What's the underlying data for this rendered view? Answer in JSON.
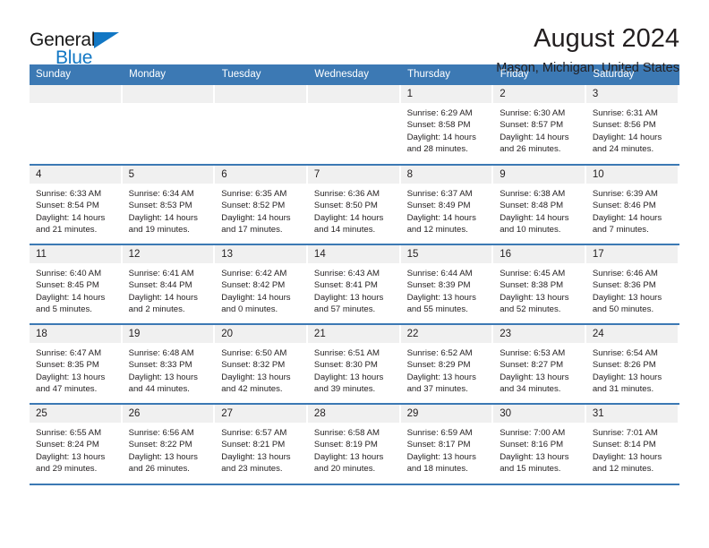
{
  "brand": {
    "name_top": "General",
    "name_bottom": "Blue",
    "accent_color": "#1277c4"
  },
  "header": {
    "title": "August 2024",
    "subtitle": "Mason, Michigan, United States"
  },
  "theme": {
    "header_blue": "#3c79b4",
    "daynum_background": "#f0f0f0",
    "text_color": "#231f20"
  },
  "calendar": {
    "weekday_headers": [
      "Sunday",
      "Monday",
      "Tuesday",
      "Wednesday",
      "Thursday",
      "Friday",
      "Saturday"
    ],
    "weeks": [
      [
        {
          "day": "",
          "lines": []
        },
        {
          "day": "",
          "lines": []
        },
        {
          "day": "",
          "lines": []
        },
        {
          "day": "",
          "lines": []
        },
        {
          "day": "1",
          "lines": [
            "Sunrise: 6:29 AM",
            "Sunset: 8:58 PM",
            "Daylight: 14 hours and 28 minutes."
          ]
        },
        {
          "day": "2",
          "lines": [
            "Sunrise: 6:30 AM",
            "Sunset: 8:57 PM",
            "Daylight: 14 hours and 26 minutes."
          ]
        },
        {
          "day": "3",
          "lines": [
            "Sunrise: 6:31 AM",
            "Sunset: 8:56 PM",
            "Daylight: 14 hours and 24 minutes."
          ]
        }
      ],
      [
        {
          "day": "4",
          "lines": [
            "Sunrise: 6:33 AM",
            "Sunset: 8:54 PM",
            "Daylight: 14 hours and 21 minutes."
          ]
        },
        {
          "day": "5",
          "lines": [
            "Sunrise: 6:34 AM",
            "Sunset: 8:53 PM",
            "Daylight: 14 hours and 19 minutes."
          ]
        },
        {
          "day": "6",
          "lines": [
            "Sunrise: 6:35 AM",
            "Sunset: 8:52 PM",
            "Daylight: 14 hours and 17 minutes."
          ]
        },
        {
          "day": "7",
          "lines": [
            "Sunrise: 6:36 AM",
            "Sunset: 8:50 PM",
            "Daylight: 14 hours and 14 minutes."
          ]
        },
        {
          "day": "8",
          "lines": [
            "Sunrise: 6:37 AM",
            "Sunset: 8:49 PM",
            "Daylight: 14 hours and 12 minutes."
          ]
        },
        {
          "day": "9",
          "lines": [
            "Sunrise: 6:38 AM",
            "Sunset: 8:48 PM",
            "Daylight: 14 hours and 10 minutes."
          ]
        },
        {
          "day": "10",
          "lines": [
            "Sunrise: 6:39 AM",
            "Sunset: 8:46 PM",
            "Daylight: 14 hours and 7 minutes."
          ]
        }
      ],
      [
        {
          "day": "11",
          "lines": [
            "Sunrise: 6:40 AM",
            "Sunset: 8:45 PM",
            "Daylight: 14 hours and 5 minutes."
          ]
        },
        {
          "day": "12",
          "lines": [
            "Sunrise: 6:41 AM",
            "Sunset: 8:44 PM",
            "Daylight: 14 hours and 2 minutes."
          ]
        },
        {
          "day": "13",
          "lines": [
            "Sunrise: 6:42 AM",
            "Sunset: 8:42 PM",
            "Daylight: 14 hours and 0 minutes."
          ]
        },
        {
          "day": "14",
          "lines": [
            "Sunrise: 6:43 AM",
            "Sunset: 8:41 PM",
            "Daylight: 13 hours and 57 minutes."
          ]
        },
        {
          "day": "15",
          "lines": [
            "Sunrise: 6:44 AM",
            "Sunset: 8:39 PM",
            "Daylight: 13 hours and 55 minutes."
          ]
        },
        {
          "day": "16",
          "lines": [
            "Sunrise: 6:45 AM",
            "Sunset: 8:38 PM",
            "Daylight: 13 hours and 52 minutes."
          ]
        },
        {
          "day": "17",
          "lines": [
            "Sunrise: 6:46 AM",
            "Sunset: 8:36 PM",
            "Daylight: 13 hours and 50 minutes."
          ]
        }
      ],
      [
        {
          "day": "18",
          "lines": [
            "Sunrise: 6:47 AM",
            "Sunset: 8:35 PM",
            "Daylight: 13 hours and 47 minutes."
          ]
        },
        {
          "day": "19",
          "lines": [
            "Sunrise: 6:48 AM",
            "Sunset: 8:33 PM",
            "Daylight: 13 hours and 44 minutes."
          ]
        },
        {
          "day": "20",
          "lines": [
            "Sunrise: 6:50 AM",
            "Sunset: 8:32 PM",
            "Daylight: 13 hours and 42 minutes."
          ]
        },
        {
          "day": "21",
          "lines": [
            "Sunrise: 6:51 AM",
            "Sunset: 8:30 PM",
            "Daylight: 13 hours and 39 minutes."
          ]
        },
        {
          "day": "22",
          "lines": [
            "Sunrise: 6:52 AM",
            "Sunset: 8:29 PM",
            "Daylight: 13 hours and 37 minutes."
          ]
        },
        {
          "day": "23",
          "lines": [
            "Sunrise: 6:53 AM",
            "Sunset: 8:27 PM",
            "Daylight: 13 hours and 34 minutes."
          ]
        },
        {
          "day": "24",
          "lines": [
            "Sunrise: 6:54 AM",
            "Sunset: 8:26 PM",
            "Daylight: 13 hours and 31 minutes."
          ]
        }
      ],
      [
        {
          "day": "25",
          "lines": [
            "Sunrise: 6:55 AM",
            "Sunset: 8:24 PM",
            "Daylight: 13 hours and 29 minutes."
          ]
        },
        {
          "day": "26",
          "lines": [
            "Sunrise: 6:56 AM",
            "Sunset: 8:22 PM",
            "Daylight: 13 hours and 26 minutes."
          ]
        },
        {
          "day": "27",
          "lines": [
            "Sunrise: 6:57 AM",
            "Sunset: 8:21 PM",
            "Daylight: 13 hours and 23 minutes."
          ]
        },
        {
          "day": "28",
          "lines": [
            "Sunrise: 6:58 AM",
            "Sunset: 8:19 PM",
            "Daylight: 13 hours and 20 minutes."
          ]
        },
        {
          "day": "29",
          "lines": [
            "Sunrise: 6:59 AM",
            "Sunset: 8:17 PM",
            "Daylight: 13 hours and 18 minutes."
          ]
        },
        {
          "day": "30",
          "lines": [
            "Sunrise: 7:00 AM",
            "Sunset: 8:16 PM",
            "Daylight: 13 hours and 15 minutes."
          ]
        },
        {
          "day": "31",
          "lines": [
            "Sunrise: 7:01 AM",
            "Sunset: 8:14 PM",
            "Daylight: 13 hours and 12 minutes."
          ]
        }
      ]
    ]
  }
}
